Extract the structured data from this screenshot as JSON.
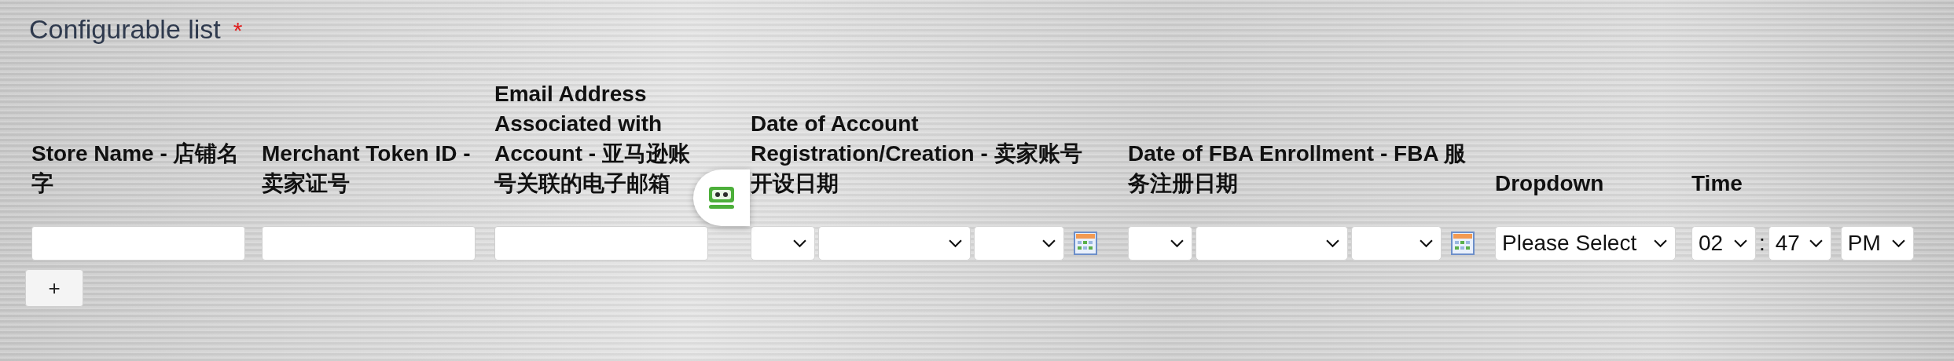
{
  "title": "Configurable list",
  "required_mark": "*",
  "columns": [
    {
      "header": "Store Name - 店铺名字",
      "kind": "text"
    },
    {
      "header": "Merchant Token ID - 卖家证号",
      "kind": "text"
    },
    {
      "header": "Email Address Associated with Account - 亚马逊账号关联的电子邮箱",
      "kind": "text"
    },
    {
      "header": "Date of Account Registration/Creation - 卖家账号开设日期",
      "kind": "date"
    },
    {
      "header": "Date of FBA Enrollment - FBA 服务注册日期",
      "kind": "date"
    },
    {
      "header": "Dropdown",
      "kind": "select",
      "value": "Please Select"
    },
    {
      "header": "Time",
      "kind": "time",
      "hour": "02",
      "separator": ":",
      "minute": "47",
      "period": "PM"
    }
  ],
  "add_button": "+"
}
